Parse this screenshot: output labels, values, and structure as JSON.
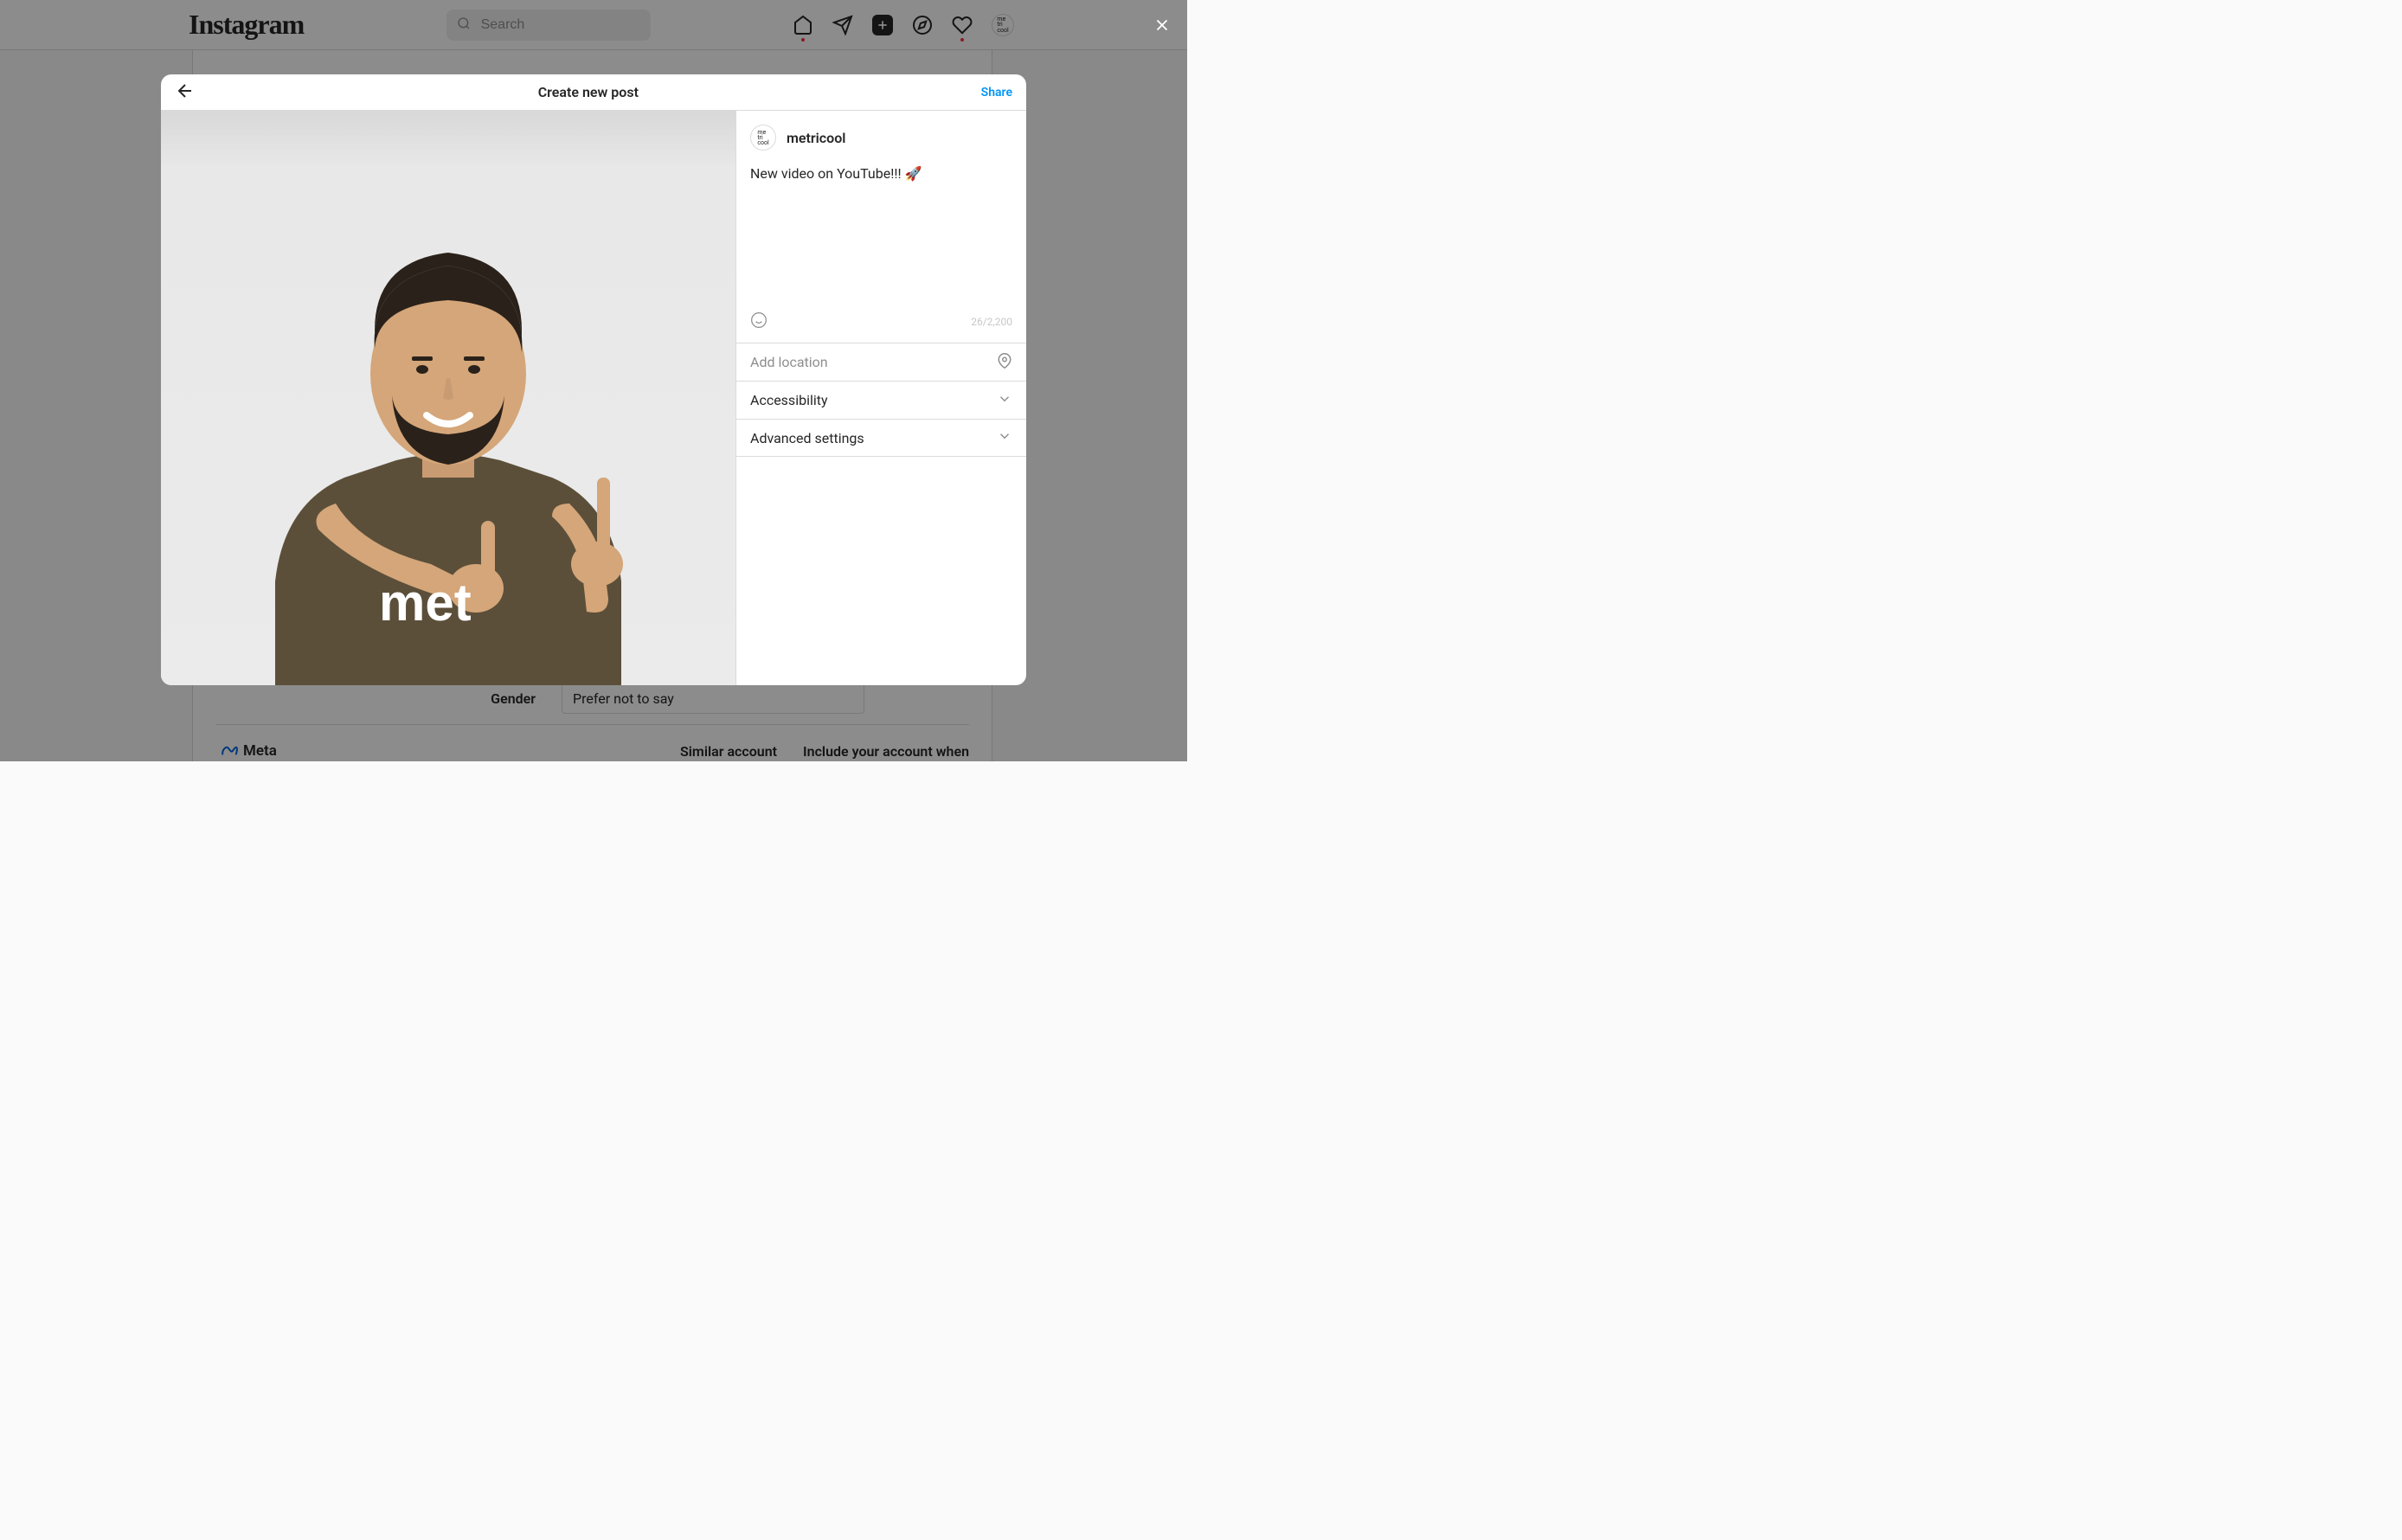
{
  "topnav": {
    "logo_text": "Instagram",
    "search_placeholder": "Search",
    "avatar_text": "me tri cool"
  },
  "background_page": {
    "gender_label": "Gender",
    "gender_value": "Prefer not to say",
    "meta_label": "Meta",
    "similar_label": "Similar account",
    "include_text": "Include your account when"
  },
  "modal": {
    "title": "Create new post",
    "share_label": "Share",
    "username": "metricool",
    "avatar_text": "me tri cool",
    "caption": "New video on YouTube!!! 🚀",
    "char_count": "26/2,200",
    "location_placeholder": "Add location",
    "accessibility_label": "Accessibility",
    "advanced_label": "Advanced settings",
    "shirt_text": "met"
  }
}
